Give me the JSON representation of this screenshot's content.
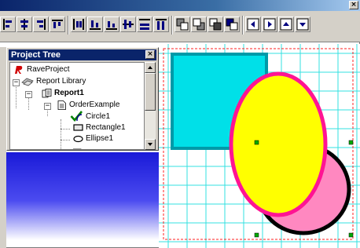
{
  "window": {
    "close_glyph": "×"
  },
  "toolbar": {
    "buttons": [
      "align-left-icon",
      "align-center-icon",
      "align-right-icon",
      "align-top-icon",
      "align-middle-icon",
      "align-bottom-icon",
      "space-horiz-icon",
      "space-vert-icon",
      "size-icon",
      "bring-front-icon",
      "send-back-icon",
      "bring-forward-icon",
      "send-backward-icon",
      "nudge-left-icon",
      "nudge-right-icon",
      "nudge-up-icon",
      "nudge-down-icon"
    ]
  },
  "project_tree": {
    "title": "Project Tree",
    "close_glyph": "×",
    "items": [
      {
        "label": "RaveProject",
        "icon": "rave-project-icon"
      },
      {
        "label": "Report Library",
        "icon": "report-library-icon",
        "expander": "−"
      },
      {
        "label": "Report1",
        "icon": "report-icon",
        "expander": "−",
        "bold": true
      },
      {
        "label": "OrderExample",
        "icon": "page-icon",
        "expander": "−"
      },
      {
        "label": "Circle1",
        "icon": "circle-icon"
      },
      {
        "label": "Rectangle1",
        "icon": "rectangle-icon"
      },
      {
        "label": "Ellipse1",
        "icon": "ellipse-icon"
      }
    ]
  },
  "canvas": {
    "grid_color": "#33e0e0",
    "margin_color": "#ff2020",
    "rectangle": {
      "fill": "#00e0e8",
      "stroke": "#009aa8"
    },
    "circle": {
      "fill": "#ff88c0",
      "stroke": "#000000"
    },
    "ellipse": {
      "fill": "#ffff00",
      "stroke": "#ff1493"
    },
    "handle_color": "#00aa00"
  }
}
